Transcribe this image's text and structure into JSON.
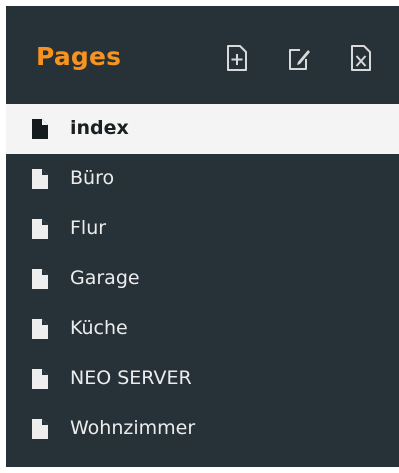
{
  "panel": {
    "title": "Pages",
    "accent_color": "#f7931e",
    "background_color": "#273238"
  },
  "toolbar": [
    {
      "icon": "add-page-icon"
    },
    {
      "icon": "edit-page-icon"
    },
    {
      "icon": "delete-page-icon"
    }
  ],
  "pages": [
    {
      "label": "index",
      "icon": "document-icon",
      "selected": true
    },
    {
      "label": "Büro",
      "icon": "document-icon",
      "selected": false
    },
    {
      "label": "Flur",
      "icon": "document-icon",
      "selected": false
    },
    {
      "label": "Garage",
      "icon": "document-icon",
      "selected": false
    },
    {
      "label": "Küche",
      "icon": "document-icon",
      "selected": false
    },
    {
      "label": "NEO SERVER",
      "icon": "document-icon",
      "selected": false
    },
    {
      "label": "Wohnzimmer",
      "icon": "document-icon",
      "selected": false
    }
  ]
}
